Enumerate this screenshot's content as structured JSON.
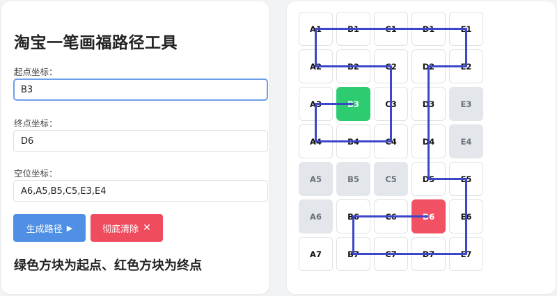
{
  "form": {
    "title": "淘宝一笔画福路径工具",
    "start_label": "起点坐标：",
    "start_value": "B3",
    "end_label": "终点坐标：",
    "end_value": "D6",
    "empty_label": "空位坐标：",
    "empty_value": "A6,A5,B5,C5,E3,E4",
    "generate_label": "生成路径",
    "clear_label": "彻底清除",
    "legend_note": "绿色方块为起点、红色方块为终点"
  },
  "board": {
    "columns": [
      "A",
      "B",
      "C",
      "D",
      "E"
    ],
    "rows": 7,
    "start": "B3",
    "end": "D6",
    "blocked": [
      "A5",
      "A6",
      "B5",
      "C5",
      "E3",
      "E4"
    ],
    "path": [
      "B3",
      "A3",
      "A4",
      "B4",
      "C4",
      "C3",
      "C2",
      "B2",
      "A2",
      "A1",
      "B1",
      "C1",
      "D1",
      "E1",
      "E2",
      "D2",
      "D3",
      "D4",
      "D5",
      "E5",
      "E6",
      "E7",
      "D7",
      "C7",
      "B7",
      "B6",
      "C6",
      "D6"
    ],
    "colors": {
      "start": "#2ecc71",
      "end": "#f25163",
      "blocked": "#e3e6ea",
      "path": "#3b46c9"
    }
  }
}
